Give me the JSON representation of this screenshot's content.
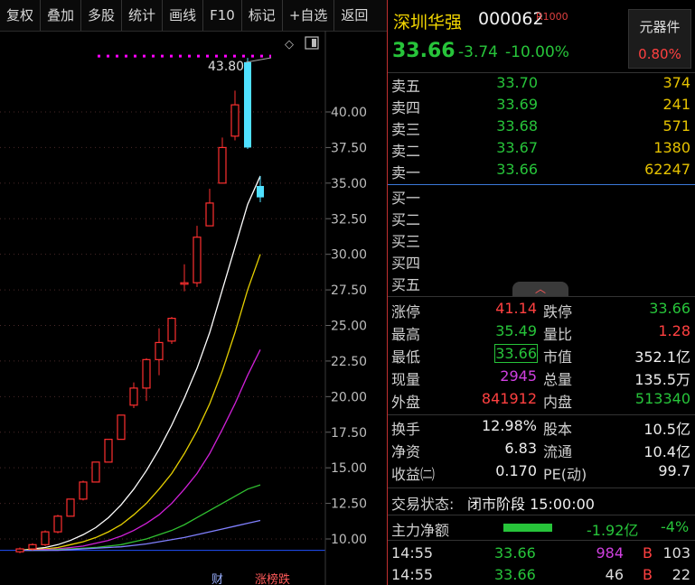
{
  "toolbar": [
    "复权",
    "叠加",
    "多股",
    "统计",
    "画线",
    "F10",
    "标记",
    "+自选",
    "返回"
  ],
  "chart": {
    "y_ticks": [
      "40.00",
      "37.50",
      "35.00",
      "32.50",
      "30.00",
      "27.50",
      "25.00",
      "22.50",
      "20.00",
      "17.50",
      "15.00",
      "12.50",
      "10.00"
    ],
    "high_label": "43.80",
    "bottom_labels": [
      "财",
      "涨榜跌"
    ]
  },
  "chart_data": {
    "type": "candlestick",
    "ylim": [
      8.5,
      44.5
    ],
    "high_marker": 43.8,
    "candles": [
      {
        "o": 9.1,
        "c": 9.3,
        "h": 9.4,
        "l": 9.0
      },
      {
        "o": 9.3,
        "c": 9.6,
        "h": 9.7,
        "l": 9.2
      },
      {
        "o": 9.6,
        "c": 10.5,
        "h": 10.6,
        "l": 9.5
      },
      {
        "o": 10.5,
        "c": 11.6,
        "h": 11.7,
        "l": 10.4
      },
      {
        "o": 11.6,
        "c": 12.8,
        "h": 12.8,
        "l": 11.6
      },
      {
        "o": 12.8,
        "c": 14.0,
        "h": 14.1,
        "l": 12.7
      },
      {
        "o": 14.0,
        "c": 15.4,
        "h": 15.4,
        "l": 14.0
      },
      {
        "o": 15.4,
        "c": 17.0,
        "h": 17.0,
        "l": 15.4
      },
      {
        "o": 17.0,
        "c": 18.7,
        "h": 18.7,
        "l": 17.0
      },
      {
        "o": 19.4,
        "c": 20.6,
        "h": 21.0,
        "l": 19.2
      },
      {
        "o": 20.6,
        "c": 22.6,
        "h": 22.7,
        "l": 19.7
      },
      {
        "o": 22.6,
        "c": 23.8,
        "h": 24.8,
        "l": 21.5
      },
      {
        "o": 23.9,
        "c": 25.5,
        "h": 25.6,
        "l": 23.7
      },
      {
        "o": 27.9,
        "c": 28.0,
        "h": 29.3,
        "l": 27.4
      },
      {
        "o": 28.0,
        "c": 31.2,
        "h": 32.0,
        "l": 27.7
      },
      {
        "o": 32.0,
        "c": 33.6,
        "h": 34.6,
        "l": 32.0
      },
      {
        "o": 35.0,
        "c": 37.5,
        "h": 38.2,
        "l": 35.0
      },
      {
        "o": 38.3,
        "c": 40.5,
        "h": 41.5,
        "l": 38.0
      },
      {
        "o": 43.5,
        "c": 37.5,
        "h": 43.8,
        "l": 37.4
      },
      {
        "o": 34.8,
        "c": 34.0,
        "h": 35.5,
        "l": 33.66
      }
    ],
    "ma": {
      "white": [
        9.2,
        9.3,
        9.4,
        9.6,
        9.9,
        10.3,
        10.8,
        11.5,
        12.4,
        13.5,
        14.8,
        16.3,
        18.0,
        19.9,
        22.0,
        24.5,
        27.5,
        30.5,
        33.5,
        35.5
      ],
      "yellow": [
        9.2,
        9.25,
        9.3,
        9.4,
        9.6,
        9.8,
        10.1,
        10.5,
        11.0,
        11.7,
        12.5,
        13.5,
        14.6,
        16.0,
        17.6,
        19.5,
        21.8,
        24.5,
        27.5,
        30.0
      ],
      "magenta": [
        9.2,
        9.2,
        9.25,
        9.3,
        9.4,
        9.5,
        9.7,
        9.9,
        10.2,
        10.6,
        11.1,
        11.7,
        12.5,
        13.5,
        14.6,
        16.0,
        17.7,
        19.5,
        21.5,
        23.3
      ],
      "green": [
        9.2,
        9.2,
        9.2,
        9.25,
        9.3,
        9.35,
        9.4,
        9.5,
        9.6,
        9.8,
        10.0,
        10.3,
        10.6,
        11.0,
        11.5,
        12.0,
        12.5,
        13.0,
        13.5,
        13.8
      ],
      "blue": [
        9.2,
        9.2,
        9.2,
        9.2,
        9.25,
        9.3,
        9.35,
        9.4,
        9.45,
        9.55,
        9.65,
        9.8,
        9.95,
        10.1,
        10.3,
        10.5,
        10.7,
        10.9,
        11.1,
        11.3
      ]
    }
  },
  "header": {
    "name": "深圳华强",
    "code": "000062",
    "tag": "R1000",
    "sector_name": "元器件",
    "sector_pct": "0.80%",
    "price": "33.66",
    "change": "-3.74",
    "change_pct": "-10.00%"
  },
  "asks": [
    {
      "label": "卖五",
      "price": "33.70",
      "vol": "374"
    },
    {
      "label": "卖四",
      "price": "33.69",
      "vol": "241"
    },
    {
      "label": "卖三",
      "price": "33.68",
      "vol": "571"
    },
    {
      "label": "卖二",
      "price": "33.67",
      "vol": "1380"
    },
    {
      "label": "卖一",
      "price": "33.66",
      "vol": "62247"
    }
  ],
  "bids": [
    {
      "label": "买一"
    },
    {
      "label": "买二"
    },
    {
      "label": "买三"
    },
    {
      "label": "买四"
    },
    {
      "label": "买五"
    }
  ],
  "stats": [
    {
      "l1": "涨停",
      "v1": "41.14",
      "c1": "red",
      "l2": "跌停",
      "v2": "33.66",
      "c2": "green"
    },
    {
      "l1": "最高",
      "v1": "35.49",
      "c1": "green",
      "l2": "量比",
      "v2": "1.28",
      "c2": "red"
    },
    {
      "l1": "最低",
      "v1": "33.66",
      "c1": "green",
      "l2": "市值",
      "v2": "352.1亿",
      "c2": "white"
    },
    {
      "l1": "现量",
      "v1": "2945",
      "c1": "mag",
      "l2": "总量",
      "v2": "135.5万",
      "c2": "white"
    },
    {
      "l1": "外盘",
      "v1": "841912",
      "c1": "red",
      "l2": "内盘",
      "v2": "513340",
      "c2": "green"
    }
  ],
  "stats2": [
    {
      "l1": "换手",
      "v1": "12.98%",
      "l2": "股本",
      "v2": "10.5亿"
    },
    {
      "l1": "净资",
      "v1": "6.83",
      "l2": "流通",
      "v2": "10.4亿"
    },
    {
      "l1": "收益㈡",
      "v1": "0.170",
      "l2": "PE(动)",
      "v2": "99.7"
    }
  ],
  "status": {
    "label": "交易状态:",
    "value": "闭市阶段 15:00:00"
  },
  "mainflow": {
    "label": "主力净额",
    "value": "-1.92亿",
    "pct": "-4%"
  },
  "ticks": [
    {
      "time": "14:55",
      "price": "33.66",
      "vol": "984",
      "dir": "B",
      "num": "103"
    },
    {
      "time": "14:55",
      "price": "33.66",
      "vol": "46",
      "dir": "B",
      "num": "22"
    }
  ]
}
